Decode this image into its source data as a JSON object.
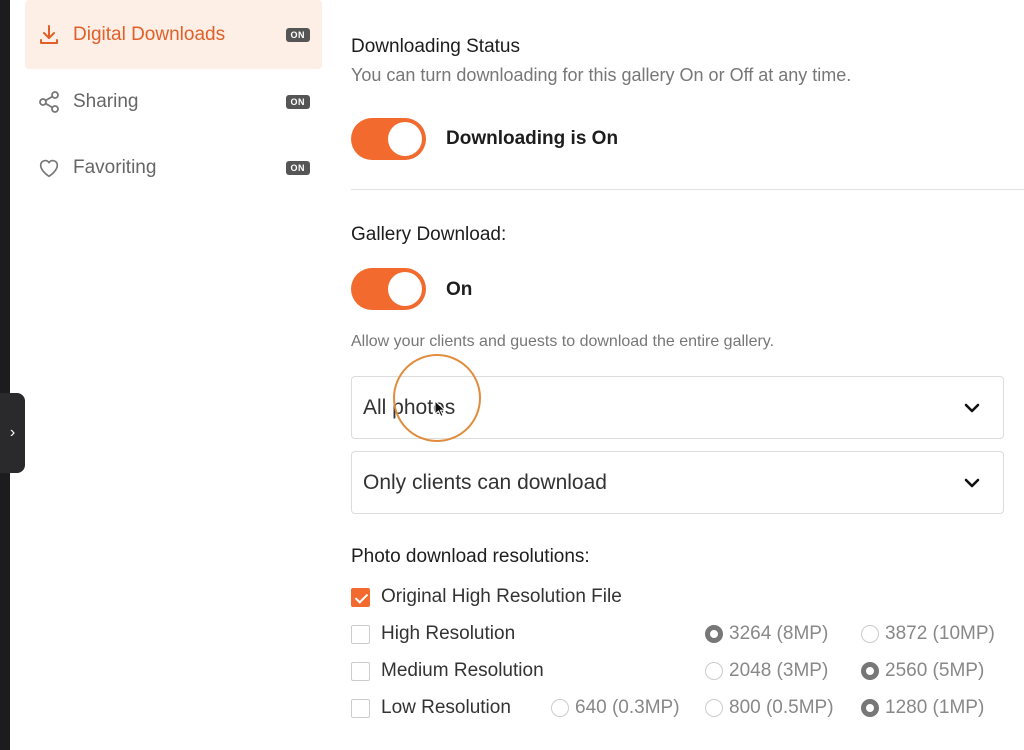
{
  "sidebar": {
    "items": [
      {
        "label": "Digital Downloads",
        "badge": "ON",
        "icon": "download-icon",
        "active": true
      },
      {
        "label": "Sharing",
        "badge": "ON",
        "icon": "share-icon",
        "active": false
      },
      {
        "label": "Favoriting",
        "badge": "ON",
        "icon": "heart-icon",
        "active": false
      }
    ]
  },
  "colors": {
    "accent": "#f26a2e",
    "active_bg": "#fdeee6",
    "active_text": "#e0602a"
  },
  "main": {
    "downloading_status": {
      "title": "Downloading Status",
      "description": "You can turn downloading for this gallery On or Off at any time.",
      "toggle_label": "Downloading is On",
      "toggle_on": true
    },
    "gallery_download": {
      "title": "Gallery Download:",
      "toggle_label": "On",
      "toggle_on": true,
      "description": "Allow your clients and guests to download the entire gallery.",
      "photos_select": "All photos",
      "access_select": "Only clients can download"
    },
    "resolutions": {
      "title": "Photo download resolutions:",
      "rows": [
        {
          "label": "Original High Resolution File",
          "checked": true,
          "options": []
        },
        {
          "label": "High Resolution",
          "checked": false,
          "options": [
            {
              "label": "3264 (8MP)",
              "selected": true
            },
            {
              "label": "3872 (10MP)",
              "selected": false
            }
          ]
        },
        {
          "label": "Medium Resolution",
          "checked": false,
          "options": [
            {
              "label": "2048 (3MP)",
              "selected": false
            },
            {
              "label": "2560 (5MP)",
              "selected": true
            }
          ]
        },
        {
          "label": "Low Resolution",
          "checked": false,
          "options": [
            {
              "label": "640 (0.3MP)",
              "selected": false
            },
            {
              "label": "800 (0.5MP)",
              "selected": false
            },
            {
              "label": "1280 (1MP)",
              "selected": true
            }
          ]
        }
      ]
    }
  }
}
